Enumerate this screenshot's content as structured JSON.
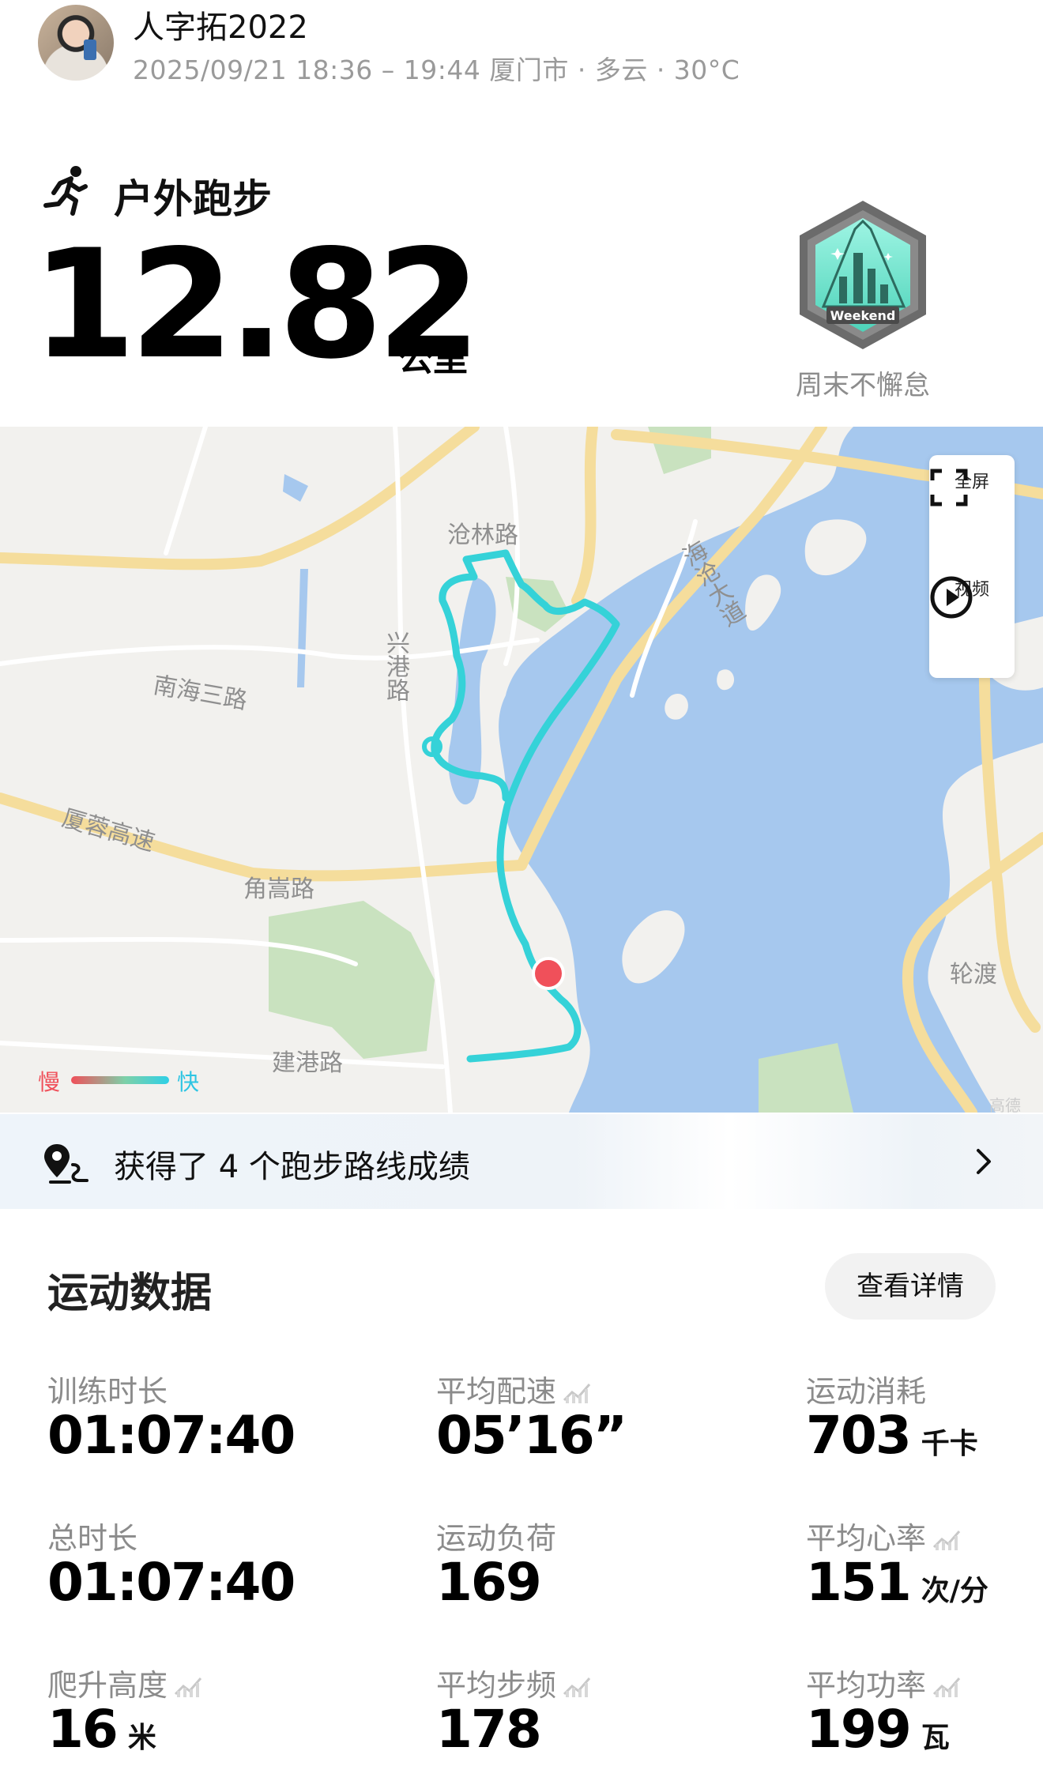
{
  "header": {
    "username": "人字拓2022",
    "meta": "2025/09/21 18:36 – 19:44 厦门市 · 多云 · 30°C"
  },
  "summary": {
    "activity_type": "户外跑步",
    "distance": "12.82",
    "distance_unit": "公里",
    "badge_text": "Weekend",
    "badge_name": "周末不懈怠",
    "icons": {
      "activity": "running-icon",
      "badge": "weekend-badge-icon"
    }
  },
  "map": {
    "labels": {
      "canglin_road": "沧林路",
      "xinggang_road": "兴港路",
      "nanhai3_road": "南海三路",
      "xiarong_expressway": "厦蓉高速",
      "jiaosong_road": "角嵩路",
      "haicang_avenue": "海沧大道",
      "jiangang_road": "建港路",
      "lundu": "轮渡"
    },
    "controls": {
      "fullscreen_label": "全屏",
      "video_label": "视频"
    },
    "legend": {
      "slow_label": "慢",
      "fast_label": "快"
    },
    "colors": {
      "water": "#a6c8ee",
      "road": "#f5dd9c",
      "park": "#c9e2bf",
      "route": "#35d2d8",
      "marker": "#f0505a"
    }
  },
  "achievement_banner": {
    "text": "获得了 4 个跑步路线成绩",
    "icons": {
      "left": "route-pin-icon",
      "right": "chevron-right-icon"
    }
  },
  "stats": {
    "title": "运动数据",
    "details_button": "查看详情",
    "items": [
      {
        "label": "训练时长",
        "value": "01:07:40",
        "unit": "",
        "has_chart": false
      },
      {
        "label": "平均配速",
        "value": "05’16”",
        "unit": "",
        "has_chart": true
      },
      {
        "label": "运动消耗",
        "value": "703",
        "unit": "千卡",
        "has_chart": false
      },
      {
        "label": "总时长",
        "value": "01:07:40",
        "unit": "",
        "has_chart": false
      },
      {
        "label": "运动负荷",
        "value": "169",
        "unit": "",
        "has_chart": false
      },
      {
        "label": "平均心率",
        "value": "151",
        "unit": "次/分",
        "has_chart": true
      },
      {
        "label": "爬升高度",
        "value": "16",
        "unit": "米",
        "has_chart": true
      },
      {
        "label": "平均步频",
        "value": "178",
        "unit": "",
        "has_chart": true
      },
      {
        "label": "平均功率",
        "value": "199",
        "unit": "瓦",
        "has_chart": true
      }
    ]
  }
}
